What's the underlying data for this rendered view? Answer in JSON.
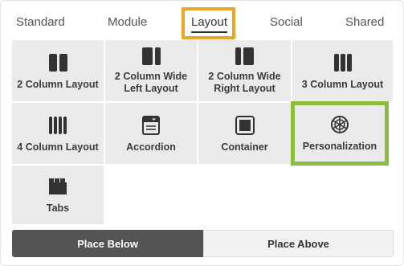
{
  "tabs": [
    {
      "label": "Standard",
      "active": false
    },
    {
      "label": "Module",
      "active": false
    },
    {
      "label": "Layout",
      "active": true
    },
    {
      "label": "Social",
      "active": false
    },
    {
      "label": "Shared",
      "active": false
    }
  ],
  "tiles": [
    {
      "label_line1": "2 Column Layout",
      "label_line2": "",
      "icon": "two-column-icon"
    },
    {
      "label_line1": "2 Column Wide",
      "label_line2": "Left Layout",
      "icon": "two-column-wide-left-icon"
    },
    {
      "label_line1": "2 Column Wide",
      "label_line2": "Right Layout",
      "icon": "two-column-wide-right-icon"
    },
    {
      "label_line1": "3 Column Layout",
      "label_line2": "",
      "icon": "three-column-icon"
    },
    {
      "label_line1": "4 Column Layout",
      "label_line2": "",
      "icon": "four-column-icon"
    },
    {
      "label_line1": "Accordion",
      "label_line2": "",
      "icon": "accordion-icon"
    },
    {
      "label_line1": "Container",
      "label_line2": "",
      "icon": "container-icon"
    },
    {
      "label_line1": "Personalization",
      "label_line2": "",
      "icon": "personalization-icon"
    },
    {
      "label_line1": "Tabs",
      "label_line2": "",
      "icon": "tabs-icon"
    }
  ],
  "buttons": {
    "place_below": "Place Below",
    "place_above": "Place Above"
  },
  "colors": {
    "tab_highlight": "#e8a72c",
    "tile_highlight": "#8bbd3c",
    "tile_bg": "#eaeaea",
    "primary_button": "#545454"
  }
}
